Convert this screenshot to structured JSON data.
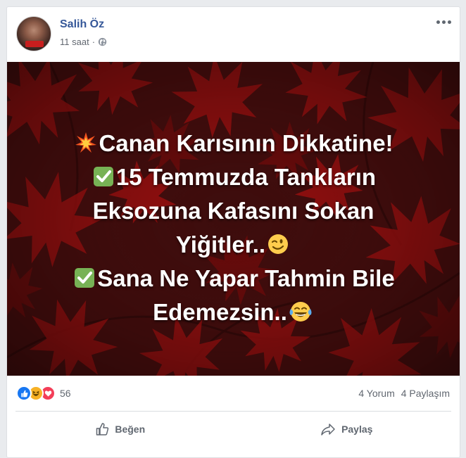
{
  "post": {
    "author_name": "Salih Öz",
    "timestamp": "11 saat",
    "separator": "·",
    "privacy_icon": "globe-icon",
    "more_icon": "more-options-icon",
    "text_lines": [
      {
        "prefix_emoji": "collision-emoji",
        "text": "Canan Karısının Dikkatine!",
        "suffix_emoji": ""
      },
      {
        "prefix_emoji": "check-mark-emoji",
        "text": "15 Temmuzda Tankların",
        "suffix_emoji": ""
      },
      {
        "prefix_emoji": "",
        "text": "Eksozuna Kafasını Sokan",
        "suffix_emoji": ""
      },
      {
        "prefix_emoji": "",
        "text": "Yiğitler..",
        "suffix_emoji": "winking-face-emoji"
      },
      {
        "prefix_emoji": "check-mark-emoji",
        "text": "Sana Ne Yapar Tahmin Bile",
        "suffix_emoji": ""
      },
      {
        "prefix_emoji": "",
        "text": "Edemezsin..",
        "suffix_emoji": "tears-of-joy-emoji"
      }
    ],
    "image_background": "red maple leaves on dark red background"
  },
  "stats": {
    "reaction_icons": [
      "like-icon",
      "haha-icon",
      "love-icon"
    ],
    "reaction_count": "56",
    "comments": "4 Yorum",
    "shares": "4 Paylaşım"
  },
  "actions": {
    "like_label": "Beğen",
    "share_label": "Paylaş"
  },
  "colors": {
    "author_link": "#365899",
    "meta_text": "#616770",
    "like_blue": "#1877f2",
    "haha_yellow": "#f7b125",
    "love_red": "#f33e58",
    "image_bg": "#3a0c0c",
    "leaf_red": "#b01212"
  }
}
